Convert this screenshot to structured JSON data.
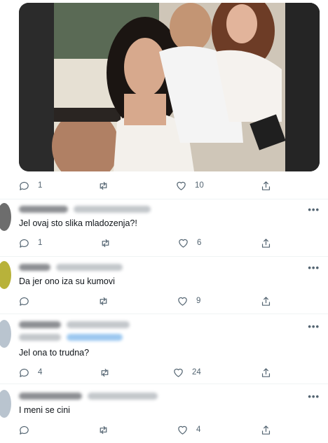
{
  "post": {
    "photo_alt_icon": "group-photo",
    "reply_count": "1",
    "retweet_count": "",
    "like_count": "10",
    "share_count": ""
  },
  "replies": [
    {
      "text": "Jel ovaj sto slika mladozenja?!",
      "more_label": "•••",
      "reply_count": "1",
      "retweet_count": "",
      "like_count": "6"
    },
    {
      "text": "Da jer ono iza su kumovi",
      "more_label": "•••",
      "reply_count": "",
      "retweet_count": "",
      "like_count": "9"
    },
    {
      "text": "Jel ona to trudna?",
      "more_label": "•••",
      "reply_count": "4",
      "retweet_count": "",
      "like_count": "24"
    },
    {
      "text": "I meni se cini",
      "more_label": "•••",
      "reply_count": "",
      "retweet_count": "",
      "like_count": "4"
    }
  ],
  "colors": {
    "icon_gray": "#536471",
    "text": "#0f1419",
    "divider": "#eff3f4",
    "mention_blue": "#1d9bf0"
  }
}
